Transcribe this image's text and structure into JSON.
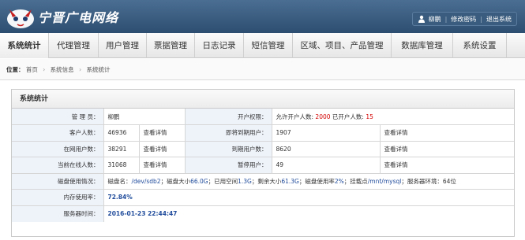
{
  "brand": {
    "name": "宁晋广电网络"
  },
  "topbar": {
    "username": "柳鹏",
    "change_password": "修改密码",
    "logout": "退出系统"
  },
  "menu": [
    {
      "label": "系统统计",
      "active": true
    },
    {
      "label": "代理管理"
    },
    {
      "label": "用户管理"
    },
    {
      "label": "票据管理"
    },
    {
      "label": "日志记录"
    },
    {
      "label": "短信管理"
    },
    {
      "label": "区域、项目、产品管理"
    },
    {
      "label": "数据库管理"
    },
    {
      "label": "系统设置"
    }
  ],
  "breadcrumb": {
    "prefix": "位置：",
    "items": [
      "首页",
      "系统信息",
      "系统统计"
    ]
  },
  "panel": {
    "title": "系统统计",
    "admin_label": "管 理 员：",
    "admin_value": "柳鹏",
    "perm_label": "开户权限：",
    "perm_text1": "允许开户人数: ",
    "perm_allowed": "2000",
    "perm_text2": " 已开户人数: ",
    "perm_opened": "15",
    "customers_label": "客户人数：",
    "customers_value": "46936",
    "expiring_label": "即将到期用户：",
    "expiring_value": "1907",
    "online_label": "在网用户数：",
    "online_value": "38291",
    "expired_label": "到期用户数：",
    "expired_value": "8620",
    "current_label": "当前在线人数：",
    "current_value": "31068",
    "paused_label": "暂停用户：",
    "paused_value": "49",
    "detail_link": "查看详情",
    "disk_label": "磁盘使用情况：",
    "disk_t1": "磁盘名：",
    "disk_name": "/dev/sdb2",
    "disk_t2": "；磁盘大小",
    "disk_size": "66.0G",
    "disk_t3": "；已用空间",
    "disk_used": "1.3G",
    "disk_t4": "；剩余大小",
    "disk_free": "61.3G",
    "disk_t5": "；磁盘使用率",
    "disk_rate": "2%",
    "disk_t6": "；挂载点",
    "disk_mount": "/mnt/mysql",
    "disk_t7": "；服务器环境：64位",
    "mem_label": "内存使用率：",
    "mem_value": "72.84%",
    "time_label": "服务器时间：",
    "time_value": "2016-01-23 22:44:47"
  }
}
